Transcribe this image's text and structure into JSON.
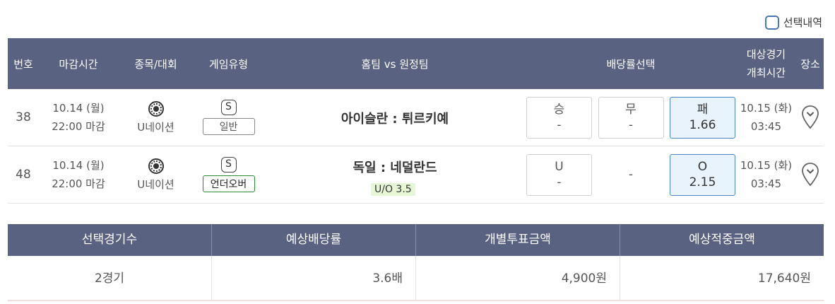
{
  "header_link": {
    "label": "선택내역"
  },
  "table": {
    "headers": {
      "no": "번호",
      "deadline": "마감시간",
      "sport": "종목/대회",
      "game_type": "게임유형",
      "teams": "홈팀 vs 원정팀",
      "odds": "배당률선택",
      "date_line1": "대상경기",
      "date_line2": "개최시간",
      "place": "장소"
    },
    "rows": [
      {
        "no": "38",
        "deadline_date": "10.14 (월)",
        "deadline_time": "22:00 마감",
        "competition": "U네이션",
        "type_badge": "S",
        "type_label": "일반",
        "teams": "아이슬란 : 튀르키예",
        "uo_tag": "",
        "odd1_label": "승",
        "odd1_value": "-",
        "odd2_label": "무",
        "odd2_value": "-",
        "odd3_label": "패",
        "odd3_value": "1.66",
        "date": "10.15 (화)",
        "time": "03:45"
      },
      {
        "no": "48",
        "deadline_date": "10.14 (월)",
        "deadline_time": "22:00 마감",
        "competition": "U네이션",
        "type_badge": "S",
        "type_label": "언더오버",
        "teams": "독일 : 네덜란드",
        "uo_tag": "U/O 3.5",
        "odd1_label": "U",
        "odd1_value": "-",
        "odd2_plain": "-",
        "odd3_label": "O",
        "odd3_value": "2.15",
        "date": "10.15 (화)",
        "time": "03:45"
      }
    ]
  },
  "summary": {
    "headers": [
      "선택경기수",
      "예상배당률",
      "개별투표금액",
      "예상적중금액"
    ],
    "values": [
      "2경기",
      "3.6배",
      "4,900원",
      "17,640원"
    ]
  },
  "colors": {
    "header_bg": "#5a6282",
    "selected_odd_bg": "#e8f3fc",
    "selected_odd_border": "#4a86c5",
    "uo_tag_bg": "#e6f7d5"
  }
}
